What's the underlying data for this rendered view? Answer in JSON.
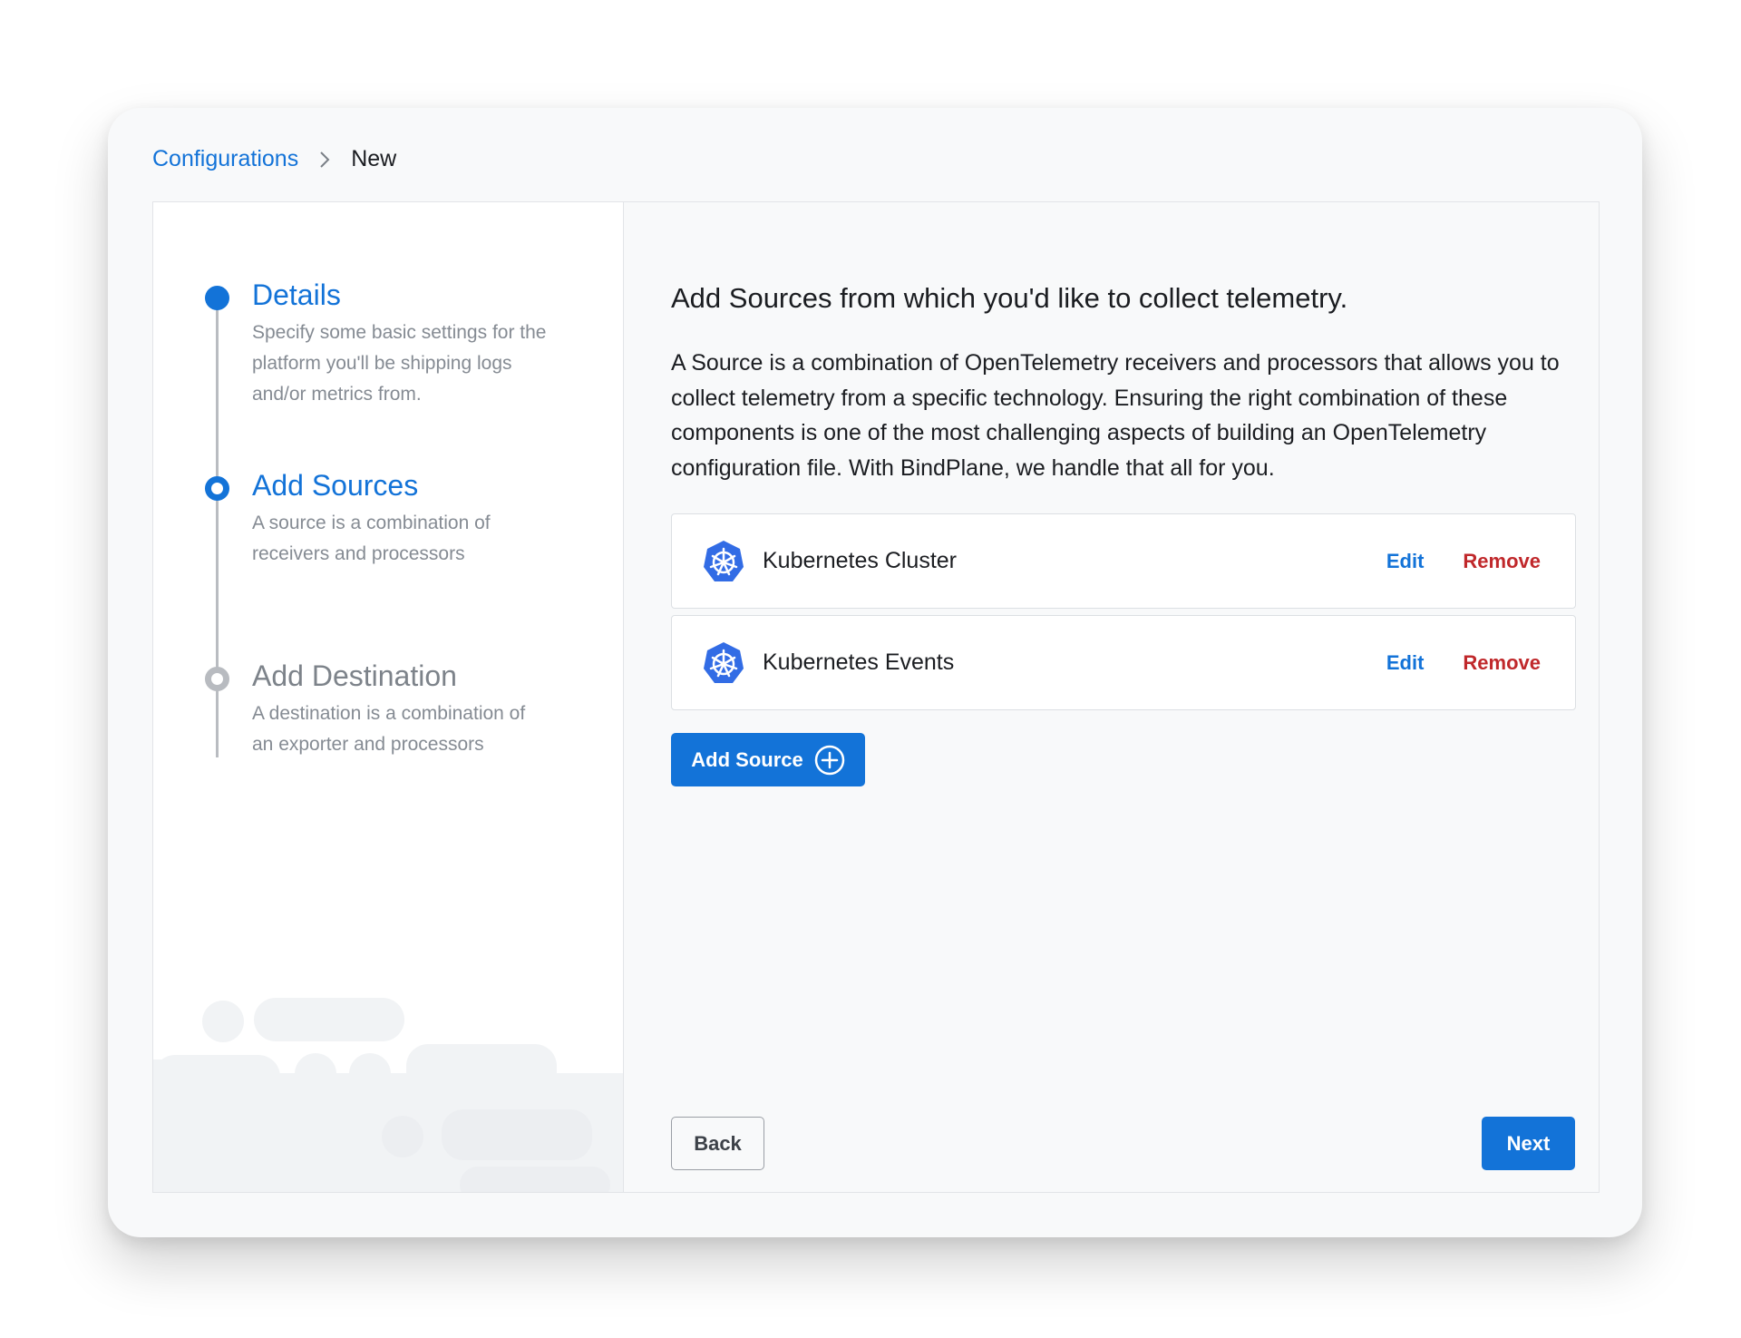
{
  "breadcrumb": {
    "parent": "Configurations",
    "current": "New"
  },
  "steps": [
    {
      "title": "Details",
      "description": "Specify some basic settings for the platform you'll be shipping logs and/or metrics from.",
      "state": "complete"
    },
    {
      "title": "Add Sources",
      "description": "A source is a combination of receivers and processors",
      "state": "current"
    },
    {
      "title": "Add Destination",
      "description": "A destination is a combination of an exporter and processors",
      "state": "upcoming"
    }
  ],
  "main": {
    "heading": "Add Sources from which you'd like to collect telemetry.",
    "intro": "A Source is a combination of OpenTelemetry receivers and processors that allows you to collect telemetry from a specific technology. Ensuring the right combination of these components is one of the most challenging aspects of building an OpenTelemetry configuration file. With BindPlane, we handle that all for you.",
    "sources": [
      {
        "name": "Kubernetes Cluster",
        "icon": "kubernetes-icon",
        "edit_label": "Edit",
        "remove_label": "Remove"
      },
      {
        "name": "Kubernetes Events",
        "icon": "kubernetes-icon",
        "edit_label": "Edit",
        "remove_label": "Remove"
      }
    ],
    "add_source_label": "Add Source",
    "back_label": "Back",
    "next_label": "Next"
  },
  "colors": {
    "accent": "#1373d8",
    "danger": "#c0282b",
    "inactive": "#b8bbc0"
  }
}
